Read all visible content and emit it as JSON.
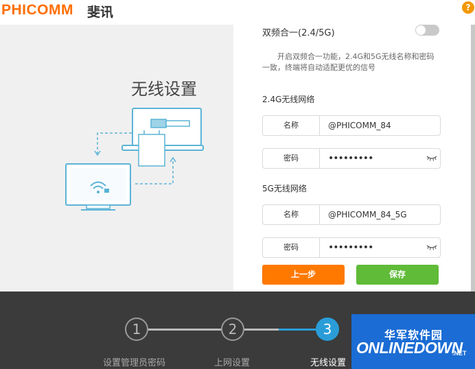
{
  "header": {
    "logo_text": "PHICOMM",
    "logo_cn": "斐讯",
    "help_label": "?"
  },
  "page": {
    "heading": "无线设置"
  },
  "form": {
    "dual_band": {
      "label": "双频合一(2.4/5G)",
      "enabled": false,
      "description": "开启双频合一功能，2.4G和5G无线名称和密码一致，终端将自动适配更优的信号"
    },
    "band24": {
      "section_label": "2.4G无线网络",
      "name_label": "名称",
      "name_value": "@PHICOMM_84",
      "pwd_label": "密码",
      "pwd_value": "•••••••••"
    },
    "band5": {
      "section_label": "5G无线网络",
      "name_label": "名称",
      "name_value": "@PHICOMM_84_5G",
      "pwd_label": "密码",
      "pwd_value": "•••••••••"
    },
    "prev_label": "上一步",
    "save_label": "保存"
  },
  "steps": [
    {
      "number": "1",
      "label": "设置管理员密码",
      "active": false
    },
    {
      "number": "2",
      "label": "上网设置",
      "active": false
    },
    {
      "number": "3",
      "label": "无线设置",
      "active": true
    }
  ],
  "watermark": {
    "cn": "华军软件园",
    "en": "ONLINEDOWN",
    "suffix": ".NET"
  },
  "colors": {
    "brand_orange": "#ff6e00",
    "prev_button": "#ff7900",
    "save_button": "#5fbb38",
    "step_active": "#2a9dd8",
    "footer_bg": "#3b3b3b"
  }
}
